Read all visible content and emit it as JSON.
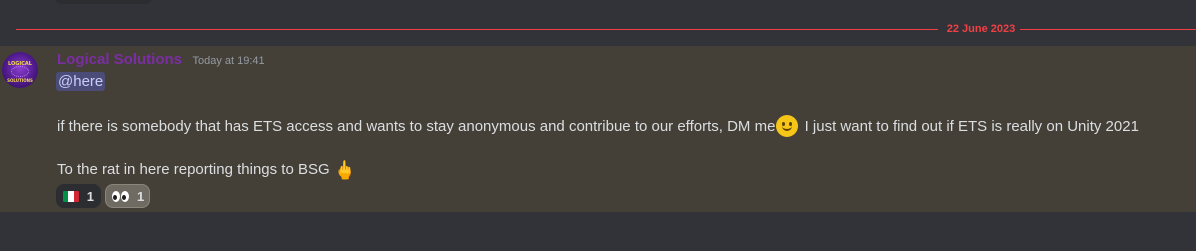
{
  "divider": {
    "date": "22 June 2023"
  },
  "message": {
    "username": "Logical Solutions",
    "timestamp": "Today at 19:41",
    "avatar_text": [
      "LOGICAL",
      "SOLUTIONS"
    ],
    "mention": "@here",
    "line1_text": "if there is somebody that has ETS access and wants to stay anonymous and contribue to our efforts, DM me",
    "line1_emoji": "slightly-smiling-face-icon",
    "line1_text2": " I just want to find out if ETS is really on Unity 2021",
    "line2_text": "To the rat in here reporting things to BSG",
    "line2_emoji": "middle-finger-icon",
    "reactions": [
      {
        "emoji": "flag-italy-icon",
        "count": "1",
        "active": false
      },
      {
        "emoji": "eyes-icon",
        "count": "1",
        "active": true
      }
    ]
  },
  "colors": {
    "background": "#313338",
    "highlight": "#443f37",
    "divider_red": "#f23f43",
    "username": "#7b2ea3",
    "mention_bg": "#5865f2"
  }
}
